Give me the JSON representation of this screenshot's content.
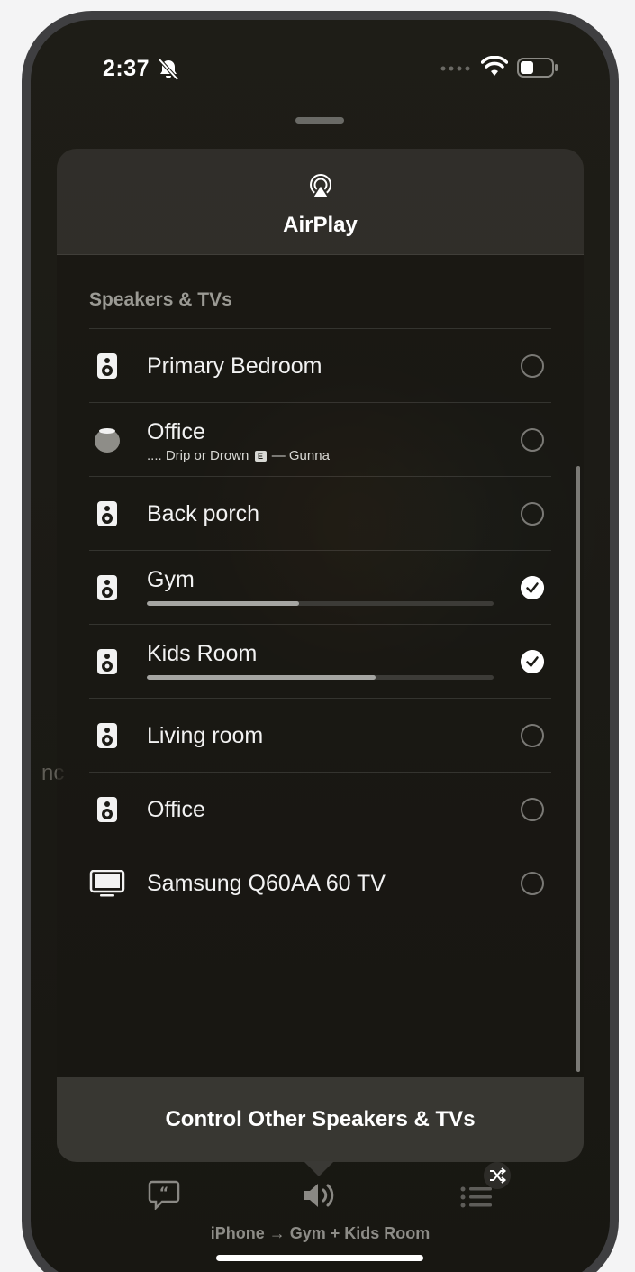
{
  "status_bar": {
    "time": "2:37",
    "silent_icon": "bell-slash-icon",
    "signal_icon": "signal-dots-icon",
    "wifi_icon": "wifi-icon",
    "battery_icon": "battery-icon"
  },
  "background": {
    "partial_text": "nc"
  },
  "sheet": {
    "icon": "airplay-icon",
    "title": "AirPlay",
    "section_label": "Speakers & TVs",
    "devices": [
      {
        "name": "Primary Bedroom",
        "icon": "speaker-icon",
        "selected": false
      },
      {
        "name": "Office",
        "icon": "homepod-mini-icon",
        "selected": false,
        "now_playing": "Drip or Drown",
        "explicit_badge": "E",
        "artist": "— Gunna"
      },
      {
        "name": "Back porch",
        "icon": "speaker-icon",
        "selected": false
      },
      {
        "name": "Gym",
        "icon": "speaker-icon",
        "selected": true,
        "volume": 0.44
      },
      {
        "name": "Kids Room",
        "icon": "speaker-icon",
        "selected": true,
        "volume": 0.66
      },
      {
        "name": "Living room",
        "icon": "speaker-icon",
        "selected": false
      },
      {
        "name": "Office",
        "icon": "speaker-icon",
        "selected": false
      },
      {
        "name": "Samsung Q60AA 60 TV",
        "icon": "tv-icon",
        "selected": false
      }
    ],
    "control_button": "Control Other Speakers & TVs"
  },
  "toolbar": {
    "lyrics_icon": "lyrics-icon",
    "speaker_icon": "speaker-wave-icon",
    "queue_icon": "queue-list-icon",
    "shuffle_icon": "shuffle-icon",
    "route": "iPhone → Gym + Kids Room"
  },
  "colors": {
    "background": "#1b1a15",
    "accent_white": "#ffffff",
    "secondary_text": "#9b9a94"
  }
}
